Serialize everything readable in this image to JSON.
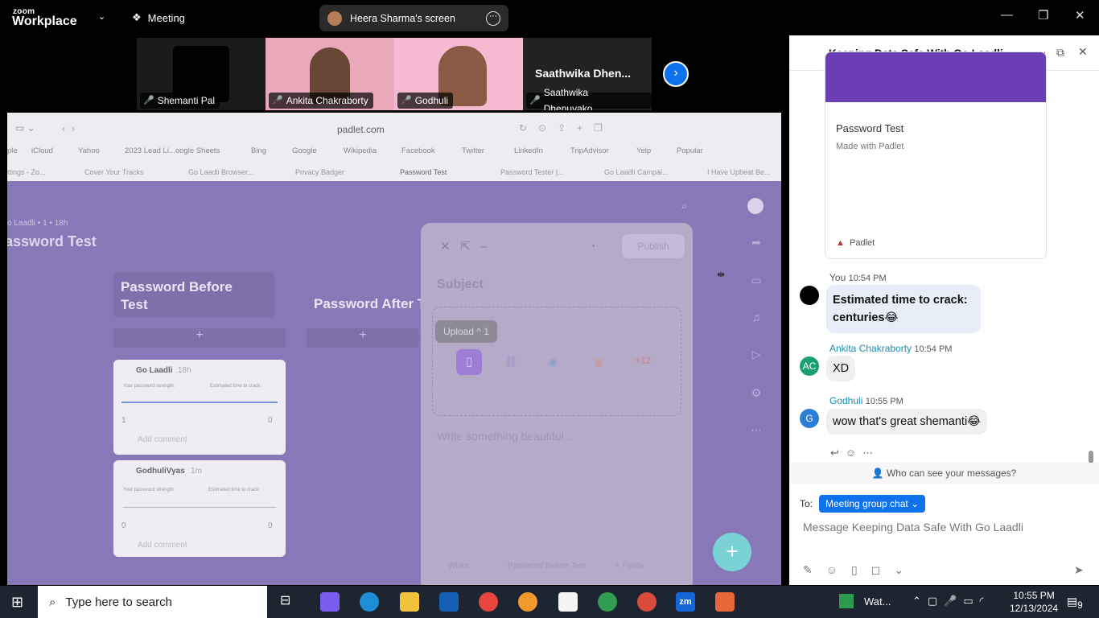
{
  "topbar": {
    "logo_top": "zoom",
    "logo_bottom": "Workplace",
    "meeting_label": "Meeting",
    "screen_label": "Heera Sharma's screen"
  },
  "participants": [
    {
      "name": "Shemanti Pal",
      "bg": "#111111"
    },
    {
      "name": "Ankita Chakraborty",
      "bg": "#e8a6b8"
    },
    {
      "name": "Godhuli",
      "bg": "#f2a9c6"
    },
    {
      "name": "Saathwika Dhenuvako...",
      "bg": "#222222",
      "display": "Saathwika  Dhen..."
    }
  ],
  "browser": {
    "url": "padlet.com",
    "bookmarks": [
      "ple",
      "iCloud",
      "Yahoo",
      "2023 Lead Li...oogle Sheets",
      "Bing",
      "Google",
      "Wikipedia",
      "Facebook",
      "Twitter",
      "LinkedIn",
      "TripAdvisor",
      "Yelp",
      "Popular"
    ],
    "tabs": [
      "ttings - Zo...",
      "Cover Your Tracks",
      "Go Laadli Browser...",
      "Privacy Badger",
      "Password Test",
      "Password Tester |...",
      "Go Laadli Campai...",
      "I Have Upbeat Be..."
    ]
  },
  "padlet": {
    "breadcrumb": "o Laadli • 1 • 18h",
    "title": "assword Test",
    "column1": "Password Before Test",
    "column2": "Password After T",
    "card1": {
      "author": "Go Laadli",
      "time": "18h",
      "left": "Your password strength:",
      "right": "Estimated time to crack:",
      "likes": "1",
      "comments": "0",
      "add": "Add comment"
    },
    "card2": {
      "author": "GodhuliVyas",
      "time": "1m",
      "left": "Your password strength:",
      "right": "Estimated time to crack:",
      "likes": "0",
      "comments": "0",
      "add": "Add comment"
    },
    "modal": {
      "publish": "Publish",
      "subject": "Subject",
      "upload": "Upload",
      "upload_count": "^ 1",
      "more": "+12",
      "placeholder": "Write something beautiful...",
      "footer_white": "White",
      "footer_section": "Password Before Test",
      "footer_fields": "+ Fields"
    }
  },
  "chat": {
    "title": "Keeping Data Safe With Go Laadli",
    "card_title": "Password Test",
    "card_sub": "Made with Padlet",
    "card_brand": "Padlet",
    "messages": [
      {
        "sender": "You",
        "time": "10:54 PM",
        "text": "Estimated time to crack: centuries😂"
      },
      {
        "sender": "Ankita Chakraborty",
        "time": "10:54 PM",
        "text": "XD",
        "initials": "AC"
      },
      {
        "sender": "Godhuli",
        "time": "10:55 PM",
        "text": "wow that's great shemanti😂",
        "initials": "G"
      }
    ],
    "who_can_see": "Who can see your messages?",
    "to_label": "To:",
    "to_pill": "Meeting group chat",
    "input_placeholder": "Message Keeping Data Safe With Go Laadli"
  },
  "taskbar": {
    "search_placeholder": "Type here to search",
    "weather": "Wat...",
    "time": "10:55 PM",
    "date": "12/13/2024",
    "badge": "9"
  }
}
